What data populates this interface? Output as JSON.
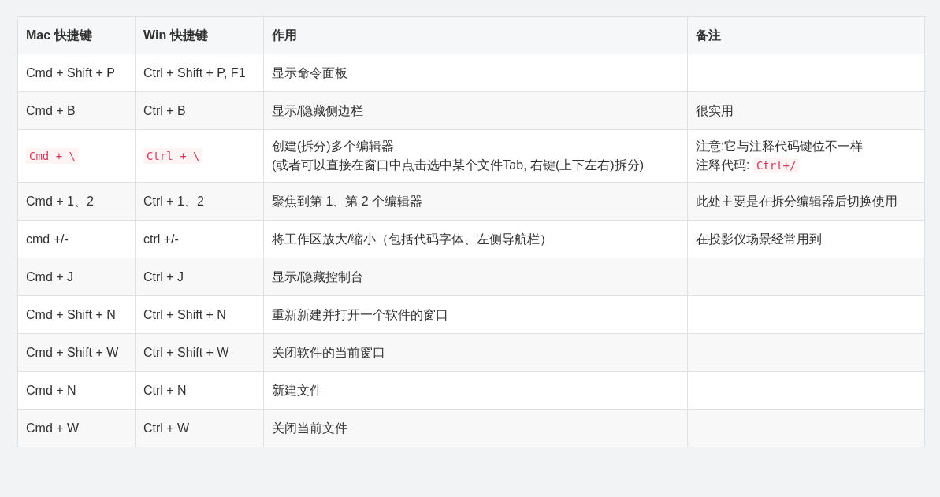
{
  "table": {
    "columns": [
      "Mac 快捷键",
      "Win 快捷键",
      "作用",
      "备注"
    ],
    "rows": [
      {
        "mac": [
          [
            {
              "kind": "text",
              "text": "Cmd + Shift + P"
            }
          ]
        ],
        "win": [
          [
            {
              "kind": "text",
              "text": "Ctrl + Shift + P, F1"
            }
          ]
        ],
        "action": [
          [
            {
              "kind": "text",
              "text": "显示命令面板"
            }
          ]
        ]
      },
      {
        "mac": [
          [
            {
              "kind": "text",
              "text": "Cmd + B"
            }
          ]
        ],
        "win": [
          [
            {
              "kind": "text",
              "text": "Ctrl + B"
            }
          ]
        ],
        "action": [
          [
            {
              "kind": "text",
              "text": "显示/隐藏侧边栏"
            }
          ]
        ],
        "note": [
          [
            {
              "kind": "text",
              "text": "很实用"
            }
          ]
        ]
      },
      {
        "mac": [
          [
            {
              "kind": "code",
              "text": "Cmd + \\"
            }
          ]
        ],
        "win": [
          [
            {
              "kind": "code",
              "text": "Ctrl + \\"
            }
          ]
        ],
        "action": [
          [
            {
              "kind": "text",
              "text": "创建(拆分)多个编辑器"
            }
          ],
          [
            {
              "kind": "text",
              "text": "(或者可以直接在窗口中点击选中某个文件Tab, 右键(上下左右)拆分)"
            }
          ]
        ],
        "note": [
          [
            {
              "kind": "text",
              "text": "注意:它与注释代码键位不一样"
            }
          ],
          [
            {
              "kind": "text",
              "text": "注释代码: "
            },
            {
              "kind": "code",
              "text": "Ctrl+/"
            }
          ]
        ]
      },
      {
        "mac": [
          [
            {
              "kind": "text",
              "text": "Cmd + 1、2"
            }
          ]
        ],
        "win": [
          [
            {
              "kind": "text",
              "text": "Ctrl + 1、2"
            }
          ]
        ],
        "action": [
          [
            {
              "kind": "text",
              "text": "聚焦到第 1、第 2 个编辑器"
            }
          ]
        ],
        "note": [
          [
            {
              "kind": "text",
              "text": "此处主要是在拆分编辑器后切换使用"
            }
          ]
        ]
      },
      {
        "mac": [
          [
            {
              "kind": "text",
              "text": "cmd +/-"
            }
          ]
        ],
        "win": [
          [
            {
              "kind": "text",
              "text": "ctrl +/-"
            }
          ]
        ],
        "action": [
          [
            {
              "kind": "text",
              "text": "将工作区放大/缩小（包括代码字体、左侧导航栏）"
            }
          ]
        ],
        "note": [
          [
            {
              "kind": "text",
              "text": "在投影仪场景经常用到"
            }
          ]
        ]
      },
      {
        "mac": [
          [
            {
              "kind": "text",
              "text": "Cmd + J"
            }
          ]
        ],
        "win": [
          [
            {
              "kind": "text",
              "text": "Ctrl + J"
            }
          ]
        ],
        "action": [
          [
            {
              "kind": "text",
              "text": "显示/隐藏控制台"
            }
          ]
        ]
      },
      {
        "mac": [
          [
            {
              "kind": "text",
              "text": "Cmd + Shift + N"
            }
          ]
        ],
        "win": [
          [
            {
              "kind": "text",
              "text": "Ctrl + Shift + N"
            }
          ]
        ],
        "action": [
          [
            {
              "kind": "text",
              "text": "重新新建并打开一个软件的窗口"
            }
          ]
        ]
      },
      {
        "mac": [
          [
            {
              "kind": "text",
              "text": "Cmd + Shift + W"
            }
          ]
        ],
        "win": [
          [
            {
              "kind": "text",
              "text": "Ctrl + Shift + W"
            }
          ]
        ],
        "action": [
          [
            {
              "kind": "text",
              "text": "关闭软件的当前窗口"
            }
          ]
        ]
      },
      {
        "mac": [
          [
            {
              "kind": "text",
              "text": "Cmd + N"
            }
          ]
        ],
        "win": [
          [
            {
              "kind": "text",
              "text": "Ctrl + N"
            }
          ]
        ],
        "action": [
          [
            {
              "kind": "text",
              "text": "新建文件"
            }
          ]
        ]
      },
      {
        "mac": [
          [
            {
              "kind": "text",
              "text": "Cmd + W"
            }
          ]
        ],
        "win": [
          [
            {
              "kind": "text",
              "text": "Ctrl + W"
            }
          ]
        ],
        "action": [
          [
            {
              "kind": "text",
              "text": "关闭当前文件"
            }
          ]
        ]
      }
    ]
  }
}
